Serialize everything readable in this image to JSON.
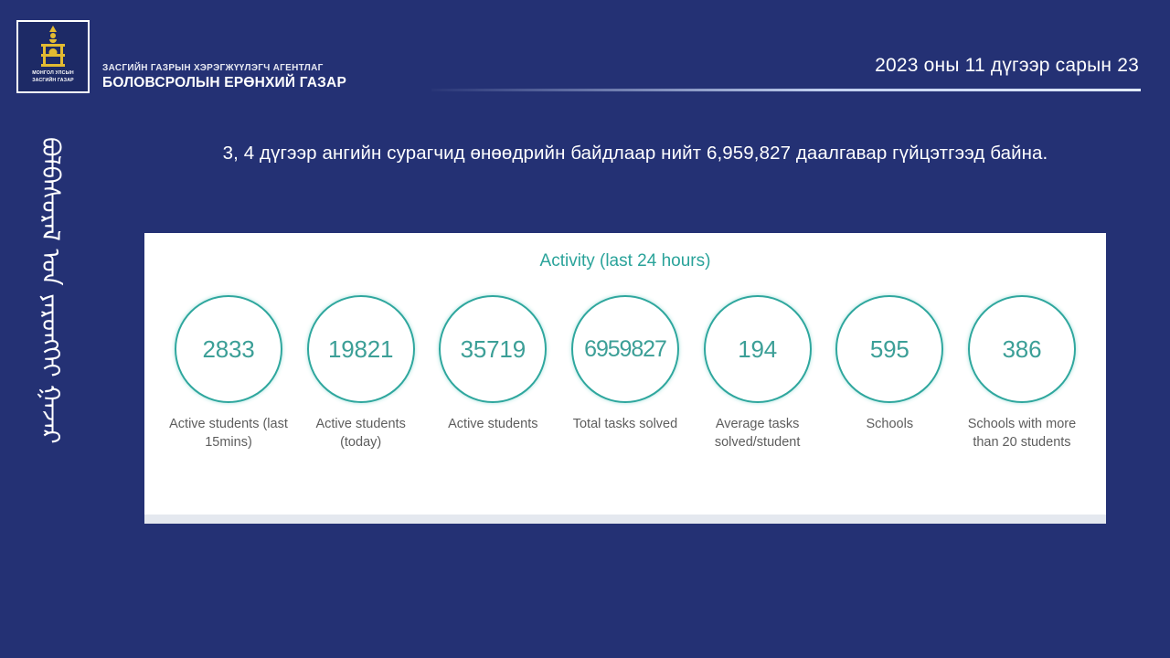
{
  "header": {
    "emblem_line1": "МОНГОЛ УЛСЫН",
    "emblem_line2": "ЗАСГИЙН ГАЗАР",
    "org_line1": "ЗАСГИЙН ГАЗРЫН ХЭРЭГЖҮҮЛЭГЧ АГЕНТЛАГ",
    "org_line2": "БОЛОВСРОЛЫН ЕРӨНХИЙ ГАЗАР",
    "date": "2023 оны 11 дүгээр сарын 23"
  },
  "sidebar": {
    "vertical_script": "ᠪᠣᠯᠪᠠᠰᠤᠷᠠᠯ ᠤᠨ ᠶᠡᠷᠦᠩᠬᠡᠢ ᠭᠠᠵᠠᠷ"
  },
  "main": {
    "title": "3, 4 дүгээр ангийн сурагчид өнөөдрийн байдлаар нийт 6,959,827 даалгавар гүйцэтгээд байна.",
    "panel_title": "Activity (last 24 hours)"
  },
  "chart_data": {
    "type": "table",
    "title": "Activity (last 24 hours)",
    "categories": [
      "Active students (last 15mins)",
      "Active students (today)",
      "Active students",
      "Total tasks solved",
      "Average tasks solved/student",
      "Schools",
      "Schools with more than 20 students"
    ],
    "values": [
      2833,
      19821,
      35719,
      6959827,
      194,
      595,
      386
    ],
    "xlabel": "",
    "ylabel": "",
    "accent_color": "#2fa79e"
  },
  "stats": [
    {
      "value": "2833",
      "label": "Active students (last 15mins)"
    },
    {
      "value": "19821",
      "label": "Active students (today)"
    },
    {
      "value": "35719",
      "label": "Active students"
    },
    {
      "value": "6959827",
      "label": "Total tasks solved"
    },
    {
      "value": "194",
      "label": "Average tasks solved/student"
    },
    {
      "value": "595",
      "label": "Schools"
    },
    {
      "value": "386",
      "label": "Schools with more than 20 students"
    }
  ],
  "colors": {
    "background": "#243174",
    "accent_teal": "#2fa79e",
    "panel": "#ffffff",
    "emblem_gold": "#e3bb32"
  }
}
